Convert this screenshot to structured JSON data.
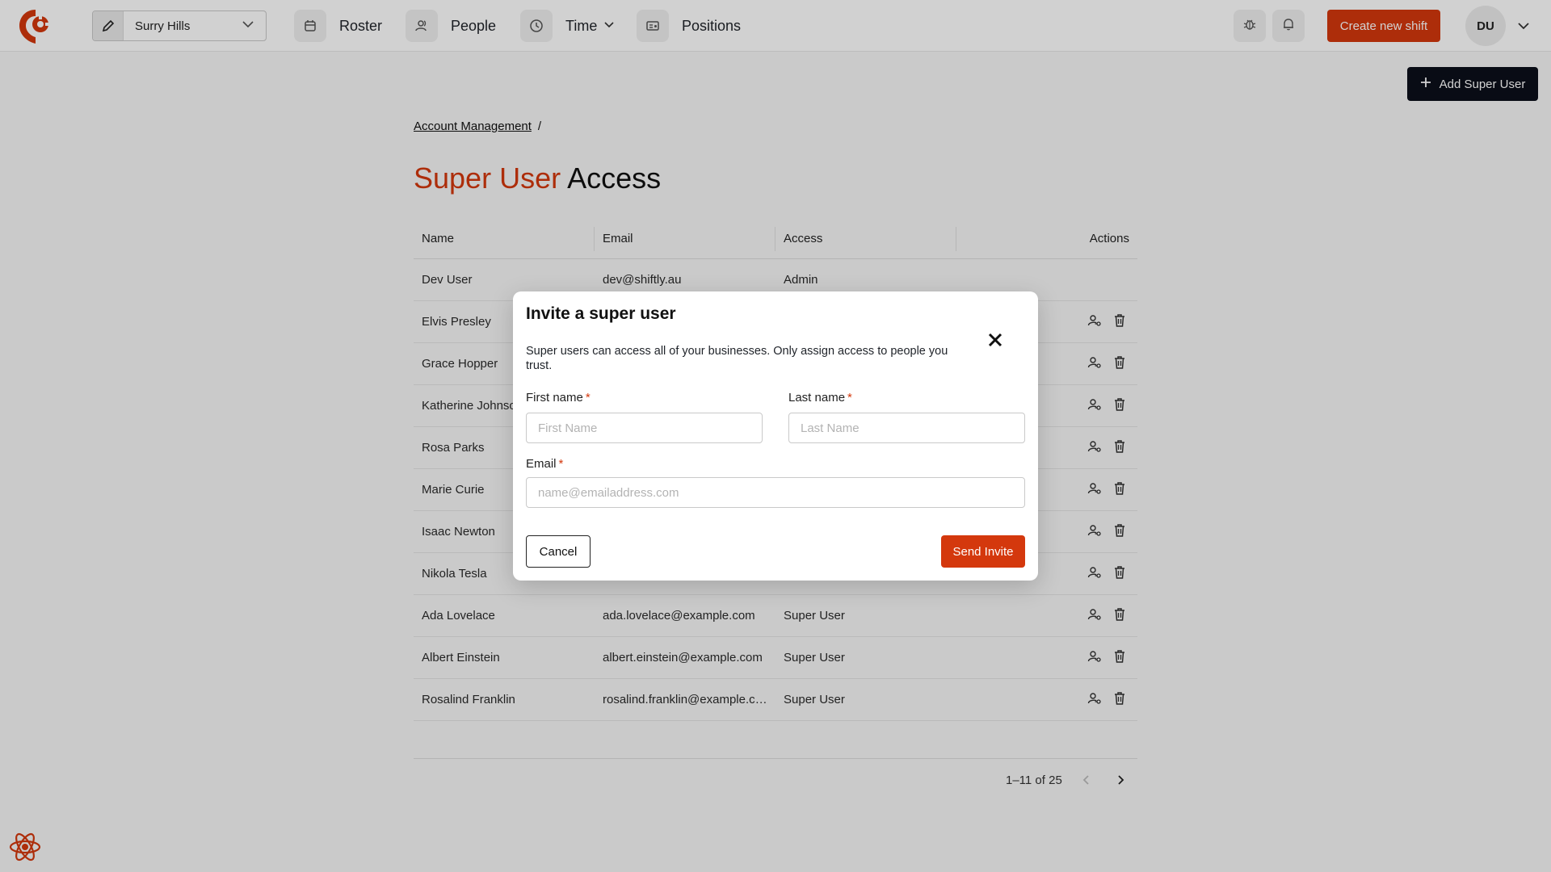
{
  "topbar": {
    "location": "Surry Hills",
    "nav": [
      {
        "label": "Roster"
      },
      {
        "label": "People"
      },
      {
        "label": "Time"
      },
      {
        "label": "Positions"
      }
    ],
    "create_label": "Create new shift",
    "avatar_initials": "DU"
  },
  "add_super_user_label": "Add Super User",
  "breadcrumb": {
    "items": [
      "Account Management"
    ],
    "separator": "/"
  },
  "title": {
    "accent": "Super User",
    "rest": "Access"
  },
  "table": {
    "headers": {
      "name": "Name",
      "email": "Email",
      "access": "Access",
      "actions": "Actions"
    },
    "rows": [
      {
        "name": "Dev User",
        "email": "dev@shiftly.au",
        "access": "Admin"
      },
      {
        "name": "Elvis Presley",
        "email": "",
        "access": ""
      },
      {
        "name": "Grace Hopper",
        "email": "",
        "access": ""
      },
      {
        "name": "Katherine Johnson",
        "email": "",
        "access": ""
      },
      {
        "name": "Rosa Parks",
        "email": "",
        "access": ""
      },
      {
        "name": "Marie Curie",
        "email": "",
        "access": ""
      },
      {
        "name": "Isaac Newton",
        "email": "",
        "access": ""
      },
      {
        "name": "Nikola Tesla",
        "email": "",
        "access": ""
      },
      {
        "name": "Ada Lovelace",
        "email": "ada.lovelace@example.com",
        "access": "Super User"
      },
      {
        "name": "Albert Einstein",
        "email": "albert.einstein@example.com",
        "access": "Super User"
      },
      {
        "name": "Rosalind Franklin",
        "email": "rosalind.franklin@example.com",
        "access": "Super User"
      }
    ]
  },
  "pagination": {
    "range": "1–11 of 25"
  },
  "modal": {
    "title": "Invite a super user",
    "description": "Super users can access all of your businesses. Only assign access to people you trust.",
    "first_name": {
      "label": "First name",
      "placeholder": "First Name",
      "value": ""
    },
    "last_name": {
      "label": "Last name",
      "placeholder": "Last Name",
      "value": ""
    },
    "email": {
      "label": "Email",
      "placeholder": "name@emailaddress.com",
      "value": ""
    },
    "required_mark": "*",
    "cancel_label": "Cancel",
    "send_label": "Send Invite"
  },
  "colors": {
    "accent": "#d4380d",
    "dark": "#0b0f1a"
  },
  "icons": [
    "logo-icon",
    "pencil-icon",
    "chevron-down-icon",
    "calendar-icon",
    "people-icon",
    "clock-icon",
    "id-card-icon",
    "bug-icon",
    "bell-icon",
    "plus-icon",
    "user-key-icon",
    "trash-icon",
    "close-icon",
    "chevron-left-icon",
    "chevron-right-icon",
    "react-devtools-icon"
  ]
}
